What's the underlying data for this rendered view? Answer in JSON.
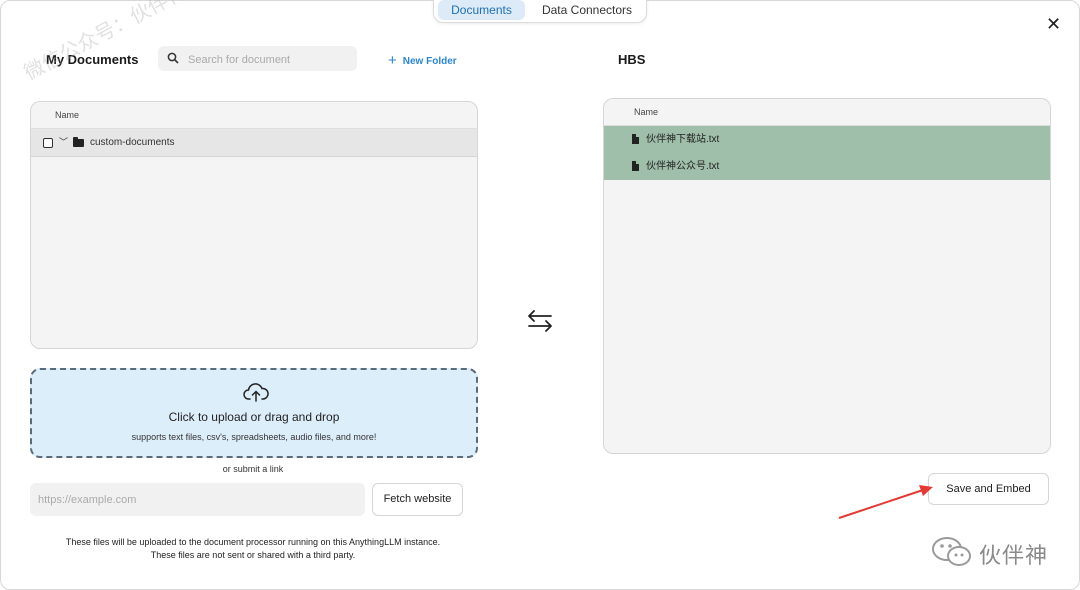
{
  "tabs": [
    {
      "label": "Documents",
      "active": true
    },
    {
      "label": "Data Connectors",
      "active": false
    }
  ],
  "left": {
    "title": "My Documents",
    "search_placeholder": "Search for document",
    "new_folder_label": "New Folder",
    "column_name": "Name",
    "folder": {
      "label": "custom-documents",
      "checked": false,
      "expanded": true
    }
  },
  "right": {
    "title": "HBS",
    "column_name": "Name",
    "files": [
      {
        "label": "伙伴神下载站.txt"
      },
      {
        "label": "伙伴神公众号.txt"
      }
    ]
  },
  "upload": {
    "main": "Click to upload or drag and drop",
    "sub": "supports text files, csv's, spreadsheets, audio files, and more!",
    "or_link": "or submit a link",
    "url_placeholder": "https://example.com",
    "fetch_label": "Fetch website",
    "disclaimer_1": "These files will be uploaded to the document processor running on this AnythingLLM instance.",
    "disclaimer_2": "These files are not sent or shared with a third party."
  },
  "save_label": "Save and Embed",
  "watermark": {
    "corner": "伙伴神",
    "diagonal": "微信公众号：伙伴神"
  },
  "colors": {
    "accent": "#2a86d4",
    "selected_row": "#9fbfaa",
    "dropzone_bg": "#ddeefb",
    "arrow": "#e53935"
  }
}
